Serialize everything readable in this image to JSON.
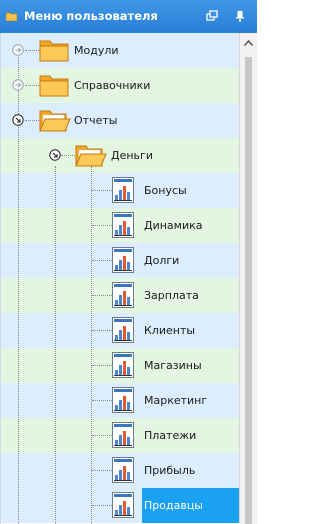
{
  "window": {
    "title": "Меню пользователя",
    "accent_color": "#2a7fd6",
    "icons": [
      "folder-icon",
      "float-window-icon",
      "pin-icon"
    ]
  },
  "tree": {
    "selected_color": "#1ba1f2",
    "items": [
      {
        "label": "Модули",
        "icon": "folder-icon",
        "expanded": false
      },
      {
        "label": "Справочники",
        "icon": "folder-icon",
        "expanded": false
      },
      {
        "label": "Отчеты",
        "icon": "folder-open-icon",
        "expanded": true
      },
      {
        "label": "Деньги",
        "icon": "folder-open-icon",
        "expanded": true
      },
      {
        "label": "Бонусы",
        "icon": "report-icon"
      },
      {
        "label": "Динамика",
        "icon": "report-icon"
      },
      {
        "label": "Долги",
        "icon": "report-icon"
      },
      {
        "label": "Зарплата",
        "icon": "report-icon"
      },
      {
        "label": "Клиенты",
        "icon": "report-icon"
      },
      {
        "label": "Магазины",
        "icon": "report-icon"
      },
      {
        "label": "Маркетинг",
        "icon": "report-icon"
      },
      {
        "label": "Платежи",
        "icon": "report-icon"
      },
      {
        "label": "Прибыль",
        "icon": "report-icon"
      },
      {
        "label": "Продавцы",
        "icon": "report-icon",
        "selected": true
      }
    ]
  }
}
